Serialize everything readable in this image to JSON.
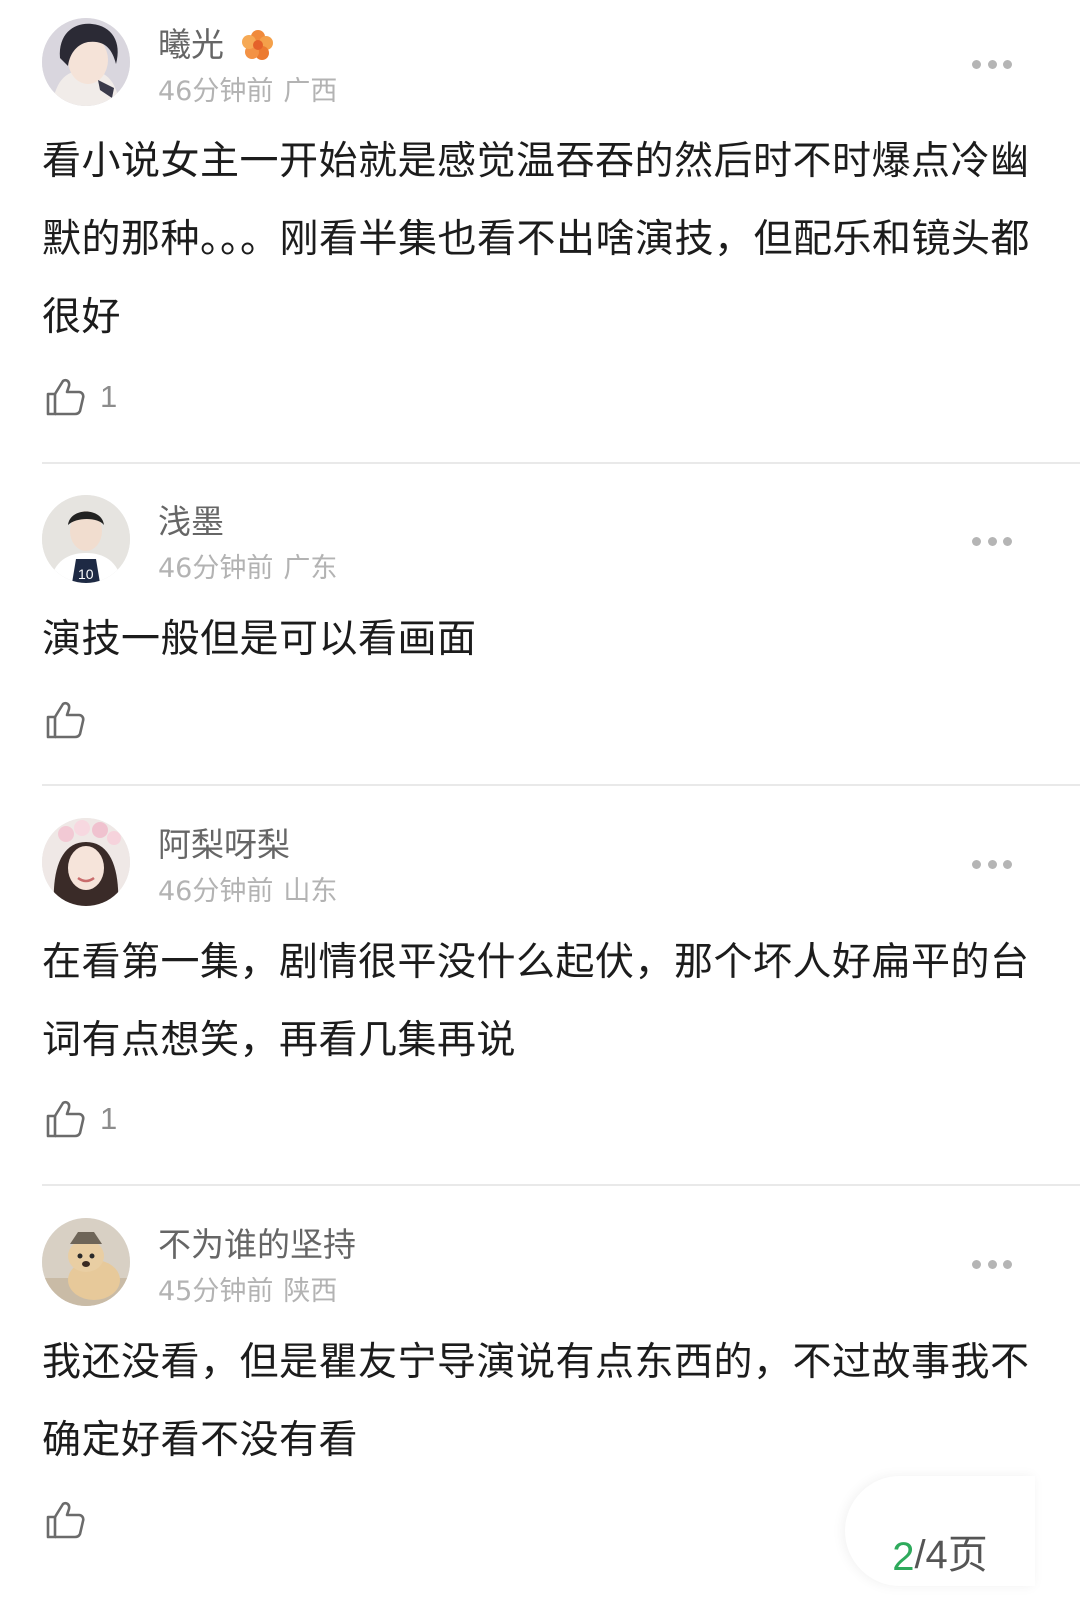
{
  "comments": [
    {
      "username": "曦光",
      "time": "46分钟前",
      "location": "广西",
      "text": "看小说女主一开始就是感觉温吞吞的然后时不时爆点冷幽默的那种。。。刚看半集也看不出啥演技，但配乐和镜头都很好",
      "likes": "1",
      "badge_icon": "flower-badge-icon"
    },
    {
      "username": "浅墨",
      "time": "46分钟前",
      "location": "广东",
      "text": "演技一般但是可以看画面",
      "likes": ""
    },
    {
      "username": "阿梨呀梨",
      "time": "46分钟前",
      "location": "山东",
      "text": "在看第一集，剧情很平没什么起伏，那个坏人好扁平的台词有点想笑，再看几集再说",
      "likes": "1"
    },
    {
      "username": "不为谁的坚持",
      "time": "45分钟前",
      "location": "陕西",
      "text": "我还没看，但是瞿友宁导演说有点东西的，不过故事我不确定好看不没有看",
      "likes": ""
    }
  ],
  "pager": {
    "current": "2",
    "total": "/4页"
  },
  "colors": {
    "accent": "#2eaa5c",
    "username": "#666666",
    "meta": "#b3b3b3",
    "divider": "#e9e9e9"
  }
}
